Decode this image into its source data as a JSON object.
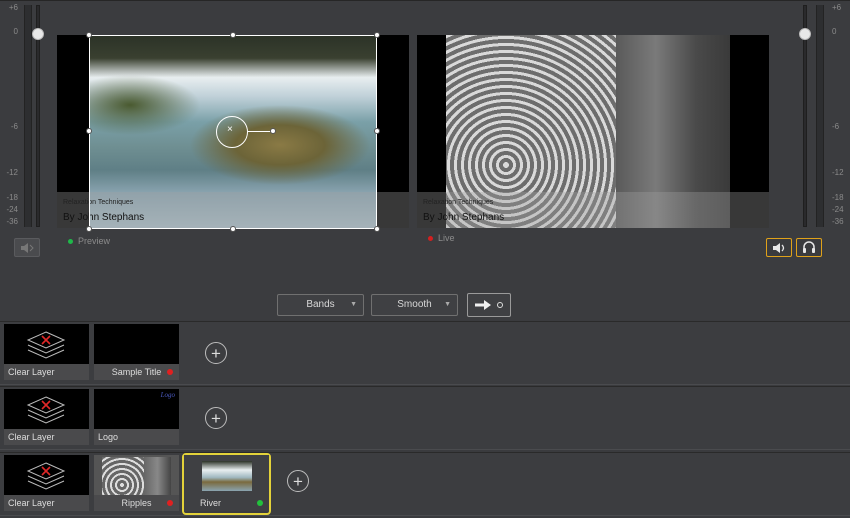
{
  "meters": {
    "scale": [
      "+6",
      "0",
      "-6",
      "-12",
      "-18",
      "-24",
      "-36"
    ],
    "left_level": 1.0,
    "right_level": 1.0
  },
  "preview": {
    "label": "Preview",
    "status_color": "#1fb84a",
    "title_small": "Relaxation Techniques",
    "title_big": "By John Stephans"
  },
  "live": {
    "label": "Live",
    "status_color": "#d22020",
    "title_small": "Relaxation Techniques",
    "title_big": "By John Stephans"
  },
  "transition": {
    "effect": "Bands",
    "easing": "Smooth",
    "go_icon": "arrow-right-icon"
  },
  "layers": [
    {
      "clear_label": "Clear Layer",
      "items": [
        {
          "label": "Sample Title",
          "status_color": "#e02020"
        }
      ]
    },
    {
      "clear_label": "Clear Layer",
      "items": [
        {
          "label": "Logo",
          "logo_text": "Logo"
        }
      ]
    },
    {
      "clear_label": "Clear Layer",
      "items": [
        {
          "label": "Ripples",
          "status_color": "#e02020"
        },
        {
          "label": "River",
          "status_color": "#22c23c",
          "selected": true
        }
      ]
    }
  ],
  "colors": {
    "accent": "#e0a21a",
    "selection": "#e3d23a"
  }
}
